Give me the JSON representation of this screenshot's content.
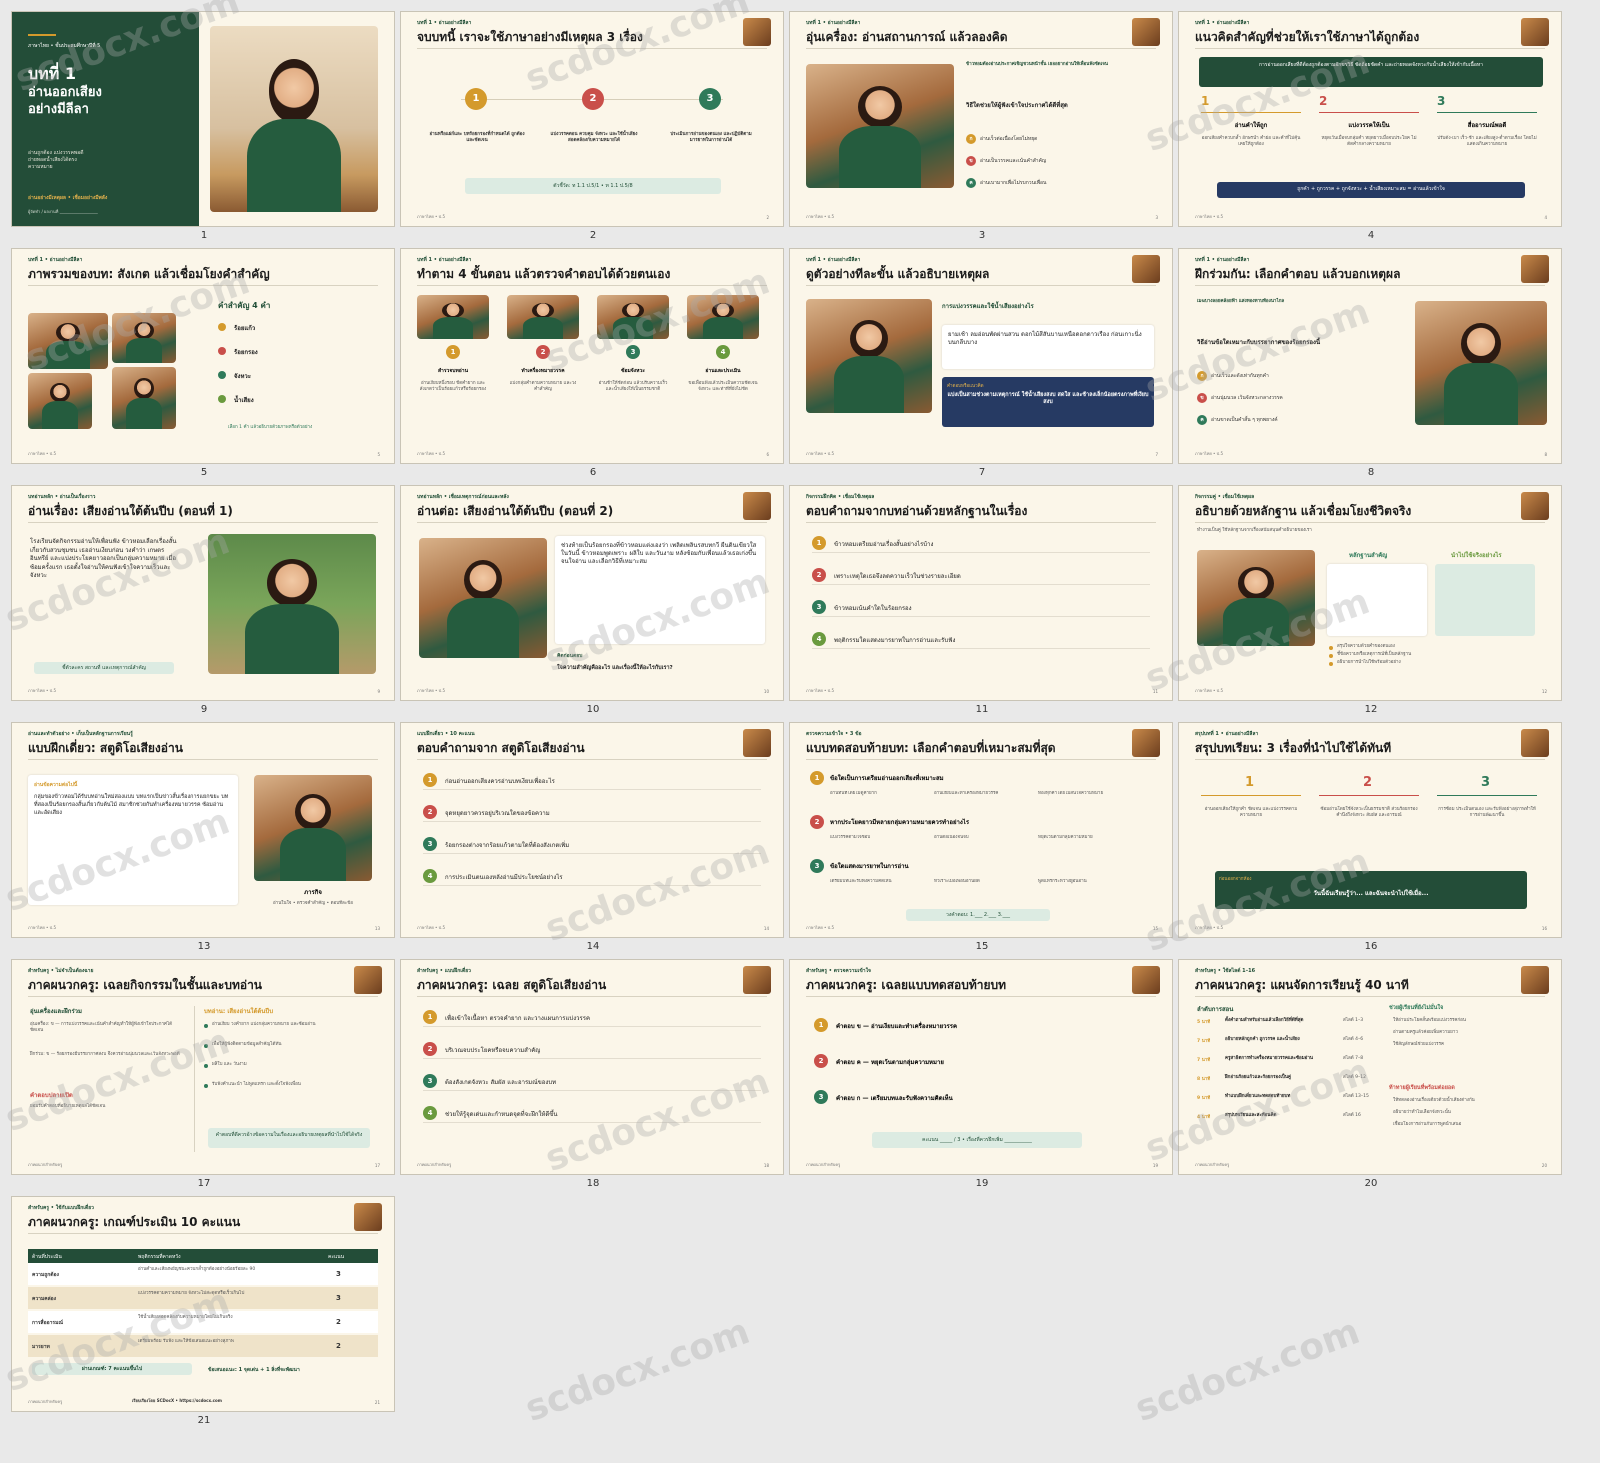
{
  "slides": [
    {
      "n": "1",
      "kicker": "ภาษาไทย • ชั้นประถมศึกษาปีที่ 5",
      "title": "บทที่ 1",
      "subtitle": "อ่านออกเสียง\nอย่างมีลีลา",
      "desc": "อ่านถูกต้อง แบ่งวรรคพอดี\nถ่ายทอดน้ำเสียงได้ตรง\nความหมาย",
      "tag": "อ่านอย่างมีเหตุผล • เชื่อมอย่างมีพลัง",
      "sign": "ผู้จัดทำ / ผลงานที่ ___________________"
    },
    {
      "n": "2",
      "kicker": "บทที่ 1 • อ่านอย่างมีลีลา",
      "title": "จบบทนี้ เราจะใช้ภาษาอย่างมีเหตุผล 3 เรื่อง",
      "steps": [
        "อ่านหรือแผ่ก์และ บทร้อยกรองที่กำหนดได้ ถูกต้องและชัดเจน",
        "แบ่งวรรคตอน ควบคุม จังหวะ และใช้น้ำเสียง สอดคล้องกับความหมายได้",
        "ประเมินการอ่านของตนเอง และปฏิบัติตาม มารยาทในการอ่านได้"
      ],
      "indicator": "ตัวชี้วัด: ท 1.1 ป.5/1 • ท 1.1 ป.5/8",
      "footer": "ภาษาไทย • ป.5",
      "page": "2"
    },
    {
      "n": "3",
      "kicker": "บทที่ 1 • อ่านอย่างมีลีลา",
      "title": "อุ่นเครื่อง: อ่านสถานการณ์ แล้วลองคิด",
      "lead": "ข้าวหอมต้องอ่านประกาศเชิญชวนหน้าชั้น เธออยากอ่านให้เพื่อนฟังชัดเจน",
      "q": "วิธีใดช่วยให้ผู้ฟังเข้าใจประกาศได้ดีที่สุด",
      "opts": [
        "อ่านเร็วต่อเนื่องโดยไม่หยุด",
        "อ่านเป็นวรรคและเน้นคำสำคัญ",
        "อ่านเบามากเพื่อไม่รบกวนเพื่อน"
      ],
      "footer": "ภาษาไทย • ป.5",
      "page": "3"
    },
    {
      "n": "4",
      "kicker": "บทที่ 1 • อ่านอย่างมีลีลา",
      "title": "แนวคิดสำคัญที่ช่วยให้เราใช้ภาษาได้ถูกต้อง",
      "banner": "การอ่านออกเสียงที่ดีต้องถูกต้องตามอักขรวิธี ชัดถ้อยชัดคำ และถ่ายทอดจังหวะกับน้ำเสียงให้เข้ากับเนื้อหา",
      "cols": [
        {
          "h": "อ่านคำให้ถูก",
          "d": "ออกเสียงคำควบกล้ำ อักษรนำ คำย่อ และคำที่ไม่คุ้นเคยให้ถูกต้อง"
        },
        {
          "h": "แบ่งวรรคให้เป็น",
          "d": "หยุดเว้นเมื่อจบกลุ่มคำ หยุดยาวเมื่อจบประโยค ไม่ตัดคำกลางความหมาย"
        },
        {
          "h": "สื่ออารมณ์พอดี",
          "d": "ปรับดัง-เบา เร็ว-ช้า และเสียงสูง-ต่ำตามเรื่อง โดยไม่แสดงเกินความหมาย"
        }
      ],
      "formula": "ถูกคำ + ถูกวรรค + ถูกจังหวะ + น้ำเสียงเหมาะสม = อ่านแล้วเข้าใจ",
      "footer": "ภาษาไทย • ป.5",
      "page": "4"
    },
    {
      "n": "5",
      "kicker": "บทที่ 1 • อ่านอย่างมีลีลา",
      "title": "ภาพรวมของบท: สังเกต แล้วเชื่อมโยงคำสำคัญ",
      "kwtitle": "คำสำคัญ 4 คำ",
      "kws": [
        "ร้อยแก้ว",
        "ร้อยกรอง",
        "จังหวะ",
        "น้ำเสียง"
      ],
      "note": "เลือก 1 คำ แล้วอธิบายด้วยภาพหรือตัวอย่าง",
      "footer": "ภาษาไทย • ป.5",
      "page": "5"
    },
    {
      "n": "6",
      "kicker": "บทที่ 1 • อ่านอย่างมีลีลา",
      "title": "ทำตาม 4 ขั้นตอน แล้วตรวจคำตอบได้ด้วยตนเอง",
      "steps": [
        {
          "h": "สำรวจบทอ่าน",
          "d": "อ่านเงียบหนึ่งรอบ ขีดคำยาก และสังเกตว่าเป็นร้อยแก้วหรือร้อยกรอง"
        },
        {
          "h": "ทำเครื่องหมายวรรค",
          "d": "แบ่งกลุ่มคำตามความหมาย และวงคำสำคัญ"
        },
        {
          "h": "ซ้อมจังหวะ",
          "d": "อ่านช้าให้ชัดก่อน แล้วปรับความเร็วและน้ำเสียงให้เป็นธรรมชาติ"
        },
        {
          "h": "อ่านและประเมิน",
          "d": "ขอเพื่อนฟังแล้วประเมินความชัดเจน จังหวะ และท่าทีที่ยังไม่ชัด"
        }
      ],
      "footer": "ภาษาไทย • ป.5",
      "page": "6"
    },
    {
      "n": "7",
      "kicker": "บทที่ 1 • อ่านอย่างมีลีลา",
      "title": "ดูตัวอย่างทีละขั้น แล้วอธิบายเหตุผล",
      "sub": "การแบ่งวรรคและใช้น้ำเสียงอย่างไร",
      "quote": "ยามเช้า ลมอ่อนพัดผ่านสวน ดอกไม้สีสันบานเหนือดอกดาวเรือง ก่อนเกาะนิ่งบนกลีบบาง",
      "boxh": "คำตอบหรือแนวคิด",
      "box": "แบ่งเป็นสามช่วงตามเหตุการณ์ ใช้น้ำเสียงสงบ สดใส และช้าลงเล็กน้อยตรงภาพที่เงียบสงบ",
      "footer": "ภาษาไทย • ป.5",
      "page": "7"
    },
    {
      "n": "8",
      "kicker": "บทที่ 1 • อ่านอย่างมีลีลา",
      "title": "ฝึกร่วมกัน: เลือกคำตอบ แล้วบอกเหตุผล",
      "lead": "เมฆบางลอยคล้อยฟ้า แสงทองทาบท้องนาไกล",
      "q": "วิธีอ่านข้อใดเหมาะกับบรรยากาศของร้อยกรองนี้",
      "opts": [
        "อ่านเร็วและดังเท่ากันทุกคำ",
        "อ่านนุ่มนวล เว้นจังหวะกลางวรรค",
        "อ่านขาดเป็นคำสั้น ๆ ทุกพยางค์"
      ],
      "footer": "ภาษาไทย • ป.5",
      "page": "8"
    },
    {
      "n": "9",
      "kicker": "บทอ่านหลัก • อ่านเป็นเรื่องราว",
      "title": "อ่านเรื่อง: เสียงอ่านใต้ต้นปีบ (ตอนที่ 1)",
      "story": "โรงเรียนจัดกิจกรรมอ่านให้เพื่อนฟัง ข้าวหอมเลือกเรื่องสั้นเกี่ยวกับสวนชุมชน เธออ่านเงียบก่อน วงคำว่า เกษตร อินทรีย์ และแบ่งประโยคยาวออกเป็นกลุ่มความหมาย เมื่อซ้อมครั้งแรก เธอตั้งใจอ่านให้คนฟังเข้าใจความเร็วและจังหวะ",
      "caption": "ชี้ตัวละคร สถานที่ และเหตุการณ์สำคัญ",
      "footer": "ภาษาไทย • ป.5",
      "page": "9"
    },
    {
      "n": "10",
      "kicker": "บทอ่านหลัก • เชื่อมเหตุการณ์ก่อนและหลัง",
      "title": "อ่านต่อ: เสียงอ่านใต้ต้นปีบ (ตอนที่ 2)",
      "story": "ช่วงท้ายเป็นร้อยกรองที่ข้าวหอมแต่งเองว่า เพลิดเพลินรสบทกวี ผืนดินเขียวใสในวันนี้ ข้าวหอมพูดเพราะ ผลิใบ และวันงาม หลังซ้อมกับเพื่อนแล้วเธอเก่งขึ้นจนใจอ่าน และเลือกวิธีที่เหมาะสม",
      "askh": "คิดก่อนตอบ",
      "ask": "ใจความสำคัญคืออะไร และเรื่องนี้ให้อะไรกับเรา?",
      "footer": "ภาษาไทย • ป.5",
      "page": "10"
    },
    {
      "n": "11",
      "kicker": "กิจกรรมฝึกคิด • เชื่อมใช้เหตุผล",
      "title": "ตอบคำถามจากบทอ่านด้วยหลักฐานในเรื่อง",
      "items": [
        "ข้าวหอมเตรียมอ่านเรื่องสั้นอย่างไรบ้าง",
        "เพราะเหตุใดเธอจึงลดความเร็วในช่วงรายละเอียด",
        "ข้าวหอมเน้นคำใดในร้อยกรอง",
        "พฤติกรรมใดแสดงมารยาทในการอ่านและรับฟัง"
      ],
      "footer": "ภาษาไทย • ป.5",
      "page": "11"
    },
    {
      "n": "12",
      "kicker": "กิจกรรมคู่ • เชื่อมใช้เหตุผล",
      "title": "อธิบายด้วยหลักฐาน แล้วเชื่อมโยงชีวิตจริง",
      "lead": "ทำงานเป็นคู่ ใช้หลักฐานจากเรื่องสนับสนุนคำอธิบายของเรา",
      "c1": "หลักฐานสำคัญ",
      "c2": "นำไปใช้จริงอย่างไร",
      "bul": [
        "สรุปใจความด้วยคำของตนเอง",
        "ชี้ข้อความหรือเหตุการณ์ที่เป็นหลักฐาน",
        "อธิบายการนำไปใช้พร้อมตัวอย่าง"
      ],
      "footer": "ภาษาไทย • ป.5",
      "page": "12"
    },
    {
      "n": "13",
      "kicker": "อ่านและทำตัวอย่าง • เก็บเป็นหลักฐานการเรียนรู้",
      "title": "แบบฝึกเดี่ยว: สตูดิโอเสียงอ่าน",
      "boxh": "อ่านข้อความต่อไปนี้",
      "box": "กลุ่มของข้าวหอมได้รับบทอ่านใหม่สองแบบ บทแรกเป็นข่าวสั้นเรื่องการแยกขยะ บทที่สองเป็นร้อยกรองสั้นเกี่ยวกับต้นไม้ สมาชิกช่วยกันทำเครื่องหมายวรรค ซ้อมอ่าน และอัดเสียง",
      "act": "ภารกิจ",
      "actd": "อ่านในใจ • ตรวจคำสำคัญ • ตอบทีละข้อ",
      "footer": "ภาษาไทย • ป.5",
      "page": "13"
    },
    {
      "n": "14",
      "kicker": "แบบฝึกเดี่ยว • 10 คะแนน",
      "title": "ตอบคำถามจาก สตูดิโอเสียงอ่าน",
      "items": [
        "ก่อนอ่านออกเสียงควรอ่านบทเงียบเพื่ออะไร",
        "จุดหยุดยาวควรอยู่บริเวณใดของข้อความ",
        "ร้อยกรองต่างจากร้อยแก้วตามใดที่ต้องสังเกตเพิ่ม",
        "การประเมินตนเองหลังอ่านมีประโยชน์อย่างไร"
      ],
      "footer": "ภาษาไทย • ป.5",
      "page": "14"
    },
    {
      "n": "15",
      "kicker": "ตรวจความเข้าใจ • 3 ข้อ",
      "title": "แบบทดสอบท้ายบท: เลือกคำตอบที่เหมาะสมที่สุด",
      "qs": [
        {
          "q": "ข้อใดเป็นการเตรียมอ่านออกเสียงที่เหมาะสม",
          "o": [
            "อ่านทันทีโดยไม่ดูคำยาก",
            "อ่านเงียบและทำเครื่องหมายวรรค",
            "ท่องทุกคำโดยไม่สนใจความหมาย"
          ]
        },
        {
          "q": "หากประโยคยาวมีหลายกลุ่มความหมายควรทำอย่างไร",
          "o": [
            "แบ่งวรรคตามใจชอบ",
            "อ่านต่อเนื่องจนจบ",
            "หยุดเว้นตามกลุ่มความหมาย"
          ]
        },
        {
          "q": "ข้อใดแสดงมารยาทในการอ่าน",
          "o": [
            "เตรียมบทและรับฟังความคิดเห็น",
            "หัวเราะเมื่อเพื่อนอ่านผิด",
            "พูดแทรกระหว่างผู้อื่นอ่าน"
          ]
        }
      ],
      "answer": "วงคำตอบ: 1.___ 2.___ 3.___",
      "footer": "ภาษาไทย • ป.5",
      "page": "15"
    },
    {
      "n": "16",
      "kicker": "สรุปบทที่ 1 • อ่านอย่างมีลีลา",
      "title": "สรุปบทเรียน: 3 เรื่องที่นำไปใช้ได้ทันที",
      "cols": [
        "อ่านออกเสียงให้ถูกคำ ชัดเจน และแบ่งวรรคตามความหมาย",
        "ซ้อมอ่านโดยใช้จังหวะเป็นธรรมชาติ ส่วนร้อยกรองคำนึงถึงจังหวะ สัมผัส และอารมณ์",
        "การซ้อม ประเมินตนเอง และรับฟังอย่างสุภาพทำให้การอ่านพัฒนาขึ้น"
      ],
      "boxh": "ก่อนออกจากห้อง",
      "box": "วันนี้ฉันเรียนรู้ว่า... และฉันจะนำไปใช้เมื่อ...",
      "footer": "ภาษาไทย • ป.5",
      "page": "16"
    },
    {
      "n": "17",
      "kicker": "สำหรับครู • ไม่จำเป็นต้องฉาย",
      "title": "ภาคผนวกครู: เฉลยกิจกรรมในชั้นและบทอ่าน",
      "lh": "อุ่นเครื่องและฝึกร่วม",
      "l1": "อุ่นเครื่อง: ข — การแบ่งวรรคและเน้นคำสำคัญทำให้ผู้ฟังเข้าใจประกาศได้ชัดเจน",
      "l2": "ฝึกร่วม: ข — ร้อยกรองมีบรรยากาศสงบ จึงควรอ่านนุ่มนวลและเว้นจังหวะพอดี",
      "lh2": "คำตอบปลายเปิด",
      "l3": "ยอมรับคำตอบที่อธิบายเหตุผลได้ชัดเจน",
      "rh": "บทอ่าน: เสียงอ่านใต้ต้นปีบ",
      "r": [
        "อ่านเงียบ วงคำยาก แบ่งกลุ่มความหมาย และซ้อมอ่าน",
        "เพื่อให้ผู้ฟังติดตามข้อมูลสำคัญได้ทัน",
        "ผลิใบ และ วันงาม",
        "รับฟังคำแนะนำ ไม่พูดแทรก และตั้งใจฟังเพื่อน"
      ],
      "rbox": "คำตอบที่ดีควรอ้างข้อความในเรื่องและอธิบายเหตุผลที่นำไปใช้ได้จริง",
      "footer": "ภาคผนวกสำหรับครู",
      "page": "17"
    },
    {
      "n": "18",
      "kicker": "สำหรับครู • แบบฝึกเดี่ยว",
      "title": "ภาคผนวกครู: เฉลย สตูดิโอเสียงอ่าน",
      "items": [
        "เพื่อเข้าใจเนื้อหา ตรวจคำยาก และวางแผนการแบ่งวรรค",
        "บริเวณจบประโยคหรือจบความสำคัญ",
        "ต้องสังเกตจังหวะ สัมผัส และอารมณ์ของบท",
        "ช่วยให้รู้จุดเด่นและกำหนดจุดที่จะฝึกให้ดีขึ้น"
      ],
      "footer": "ภาคผนวกสำหรับครู",
      "page": "18"
    },
    {
      "n": "19",
      "kicker": "สำหรับครู • ตรวจความเข้าใจ",
      "title": "ภาคผนวกครู: เฉลยแบบทดสอบท้ายบท",
      "items": [
        "คำตอบ ข — อ่านเงียบและทำเครื่องหมายวรรค",
        "คำตอบ ค — หยุดเว้นตามกลุ่มความหมาย",
        "คำตอบ ก — เตรียมบทและรับฟังความคิดเห็น"
      ],
      "score": "คะแนน _____ / 3 • เรื่องที่ควรฝึกเพิ่ม ___________",
      "footer": "ภาคผนวกสำหรับครู",
      "page": "19"
    },
    {
      "n": "20",
      "kicker": "สำหรับครู • ใช้สไลด์ 1–16",
      "title": "ภาคผนวกครู: แผนจัดการเรียนรู้ 40 นาที",
      "lh": "ลำดับการสอน",
      "plan": [
        {
          "t": "5 นาที",
          "d": "ตั้งคำถามสำหรับอ่านแล้วเลือกวิธีที่ดีที่สุด",
          "s": "สไลด์ 1–3"
        },
        {
          "t": "7 นาที",
          "d": "อธิบายหลักถูกคำ ถูกวรรค และน้ำเสียง",
          "s": "สไลด์ 4–6"
        },
        {
          "t": "7 นาที",
          "d": "ครูสาธิตการทำเครื่องหมายวรรคและซ้อมอ่าน",
          "s": "สไลด์ 7–8"
        },
        {
          "t": "8 นาที",
          "d": "ฝึกอ่านร้อยแก้วและร้อยกรองเป็นคู่",
          "s": "สไลด์ 9–12"
        },
        {
          "t": "9 นาที",
          "d": "ทำแบบฝึกเดี่ยวและทดสอบท้ายบท",
          "s": "สไลด์ 13–15"
        },
        {
          "t": "4 นาที",
          "d": "สรุปบทเรียนและสะท้อนคิด",
          "s": "สไลด์ 16"
        }
      ],
      "rh": "ช่วยผู้เรียนที่ยังไม่มั่นใจ",
      "r": [
        "ให้อ่านประโยคสั้นพร้อมแบ่งวรรคก่อน",
        "อ่านตามครูแล้วค่อยเพิ่มความยาว",
        "ใช้สัญลักษณ์ช่วยแบ่งวรรค"
      ],
      "rh2": "ท้าทายผู้เรียนที่พร้อมต่อยอด",
      "r2": [
        "ให้ทดลองอ่านเรื่องเดียวด้วยน้ำเสียงต่างกัน",
        "อธิบายว่าทำไมเลือกจังหวะนั้น",
        "เชื่อมโยงการอ่านกับการพูดนำเสนอ"
      ],
      "footer": "ภาคผนวกสำหรับครู",
      "page": "20"
    },
    {
      "n": "21",
      "kicker": "สำหรับครู • ใช้กับแบบฝึกเดี่ยว",
      "title": "ภาคผนวกครู: เกณฑ์ประเมิน 10 คะแนน",
      "head": [
        "ด้านที่ประเมิน",
        "พฤติกรรมที่คาดหวัง",
        "คะแนน"
      ],
      "rows": [
        {
          "a": "ความถูกต้อง",
          "b": "อ่านคำและเสียงพยัญชนะควบกล้ำถูกต้องอย่างน้อยร้อยละ 90",
          "c": "3"
        },
        {
          "a": "ความคล่อง",
          "b": "แบ่งวรรคตามความหมาย จังหวะไม่สะดุดหรือเร็วเกินไป",
          "c": "3"
        },
        {
          "a": "การสื่ออารมณ์",
          "b": "ใช้น้ำเสียงสอดคล้องกับความหมายโดยไม่เกินจริง",
          "c": "2"
        },
        {
          "a": "มารยาท",
          "b": "เตรียมพร้อม รับฟัง และให้ข้อเสนอแนะอย่างสุภาพ",
          "c": "2"
        }
      ],
      "pass": "ผ่านเกณฑ์: 7 คะแนนขึ้นไป",
      "fb": "ข้อเสนอแนะ: 1 จุดเด่น + 1 สิ่งที่จะพัฒนา",
      "credit": "เรียบเรียงโดย SCDocX • https://scdocx.com",
      "footer": "ภาคผนวกสำหรับครู",
      "page": "21"
    }
  ],
  "watermark": "scdocx.com",
  "colors": {
    "green": "#234d38",
    "cream": "#fbf6e9",
    "gold": "#d49a2c",
    "red": "#c94f4a",
    "teal": "#2f7a5a",
    "navy": "#263a63"
  }
}
